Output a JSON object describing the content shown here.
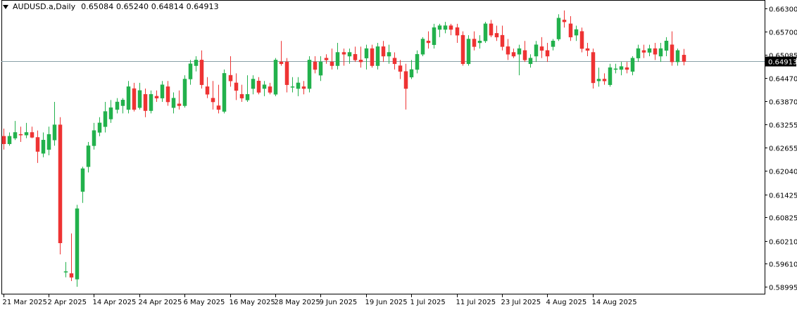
{
  "header": {
    "symbol": "AUDUSD.a,Daily",
    "open": "0.65084",
    "high": "0.65240",
    "low": "0.64814",
    "close": "0.64913"
  },
  "colors": {
    "bull": "#22b14c",
    "bear": "#ee3333",
    "current_price_line": "#8aa0a8",
    "axis": "#000000",
    "background": "#ffffff"
  },
  "chart_data": {
    "type": "candlestick",
    "symbol": "AUDUSD.a",
    "timeframe": "Daily",
    "ylim": [
      0.588,
      0.6645
    ],
    "y_ticks": [
      "0.66300",
      "0.65700",
      "0.65085",
      "0.64470",
      "0.63870",
      "0.63255",
      "0.62655",
      "0.62040",
      "0.61425",
      "0.60825",
      "0.60210",
      "0.59610",
      "0.58995"
    ],
    "current_price": "0.64913",
    "x_labels": [
      "21 Mar 2025",
      "2 Apr 2025",
      "14 Apr 2025",
      "24 Apr 2025",
      "6 May 2025",
      "16 May 2025",
      "28 May 2025",
      "9 Jun 2025",
      "19 Jun 2025",
      "1 Jul 2025",
      "11 Jul 2025",
      "23 Jul 2025",
      "4 Aug 2025",
      "14 Aug 2025"
    ],
    "x_label_index": [
      0,
      8,
      16,
      24,
      32,
      40,
      48,
      56,
      64,
      72,
      80,
      88,
      96,
      104
    ],
    "candles": [
      {
        "o": 0.6295,
        "h": 0.6315,
        "l": 0.626,
        "c": 0.6275
      },
      {
        "o": 0.6275,
        "h": 0.6305,
        "l": 0.627,
        "c": 0.6295
      },
      {
        "o": 0.629,
        "h": 0.6335,
        "l": 0.6285,
        "c": 0.6305
      },
      {
        "o": 0.63,
        "h": 0.632,
        "l": 0.628,
        "c": 0.6298
      },
      {
        "o": 0.6298,
        "h": 0.633,
        "l": 0.629,
        "c": 0.6305
      },
      {
        "o": 0.6305,
        "h": 0.632,
        "l": 0.629,
        "c": 0.6292
      },
      {
        "o": 0.6292,
        "h": 0.631,
        "l": 0.6225,
        "c": 0.6255
      },
      {
        "o": 0.625,
        "h": 0.6305,
        "l": 0.624,
        "c": 0.6285
      },
      {
        "o": 0.626,
        "h": 0.632,
        "l": 0.6245,
        "c": 0.63
      },
      {
        "o": 0.6285,
        "h": 0.6385,
        "l": 0.627,
        "c": 0.6325
      },
      {
        "o": 0.6325,
        "h": 0.6345,
        "l": 0.5985,
        "c": 0.6015
      },
      {
        "o": 0.594,
        "h": 0.5965,
        "l": 0.5925,
        "c": 0.594
      },
      {
        "o": 0.5935,
        "h": 0.604,
        "l": 0.5915,
        "c": 0.5925
      },
      {
        "o": 0.592,
        "h": 0.6115,
        "l": 0.59,
        "c": 0.6105
      },
      {
        "o": 0.615,
        "h": 0.6215,
        "l": 0.612,
        "c": 0.621
      },
      {
        "o": 0.6215,
        "h": 0.628,
        "l": 0.62,
        "c": 0.627
      },
      {
        "o": 0.627,
        "h": 0.633,
        "l": 0.626,
        "c": 0.631
      },
      {
        "o": 0.6305,
        "h": 0.6345,
        "l": 0.6295,
        "c": 0.633
      },
      {
        "o": 0.632,
        "h": 0.6385,
        "l": 0.6305,
        "c": 0.636
      },
      {
        "o": 0.634,
        "h": 0.639,
        "l": 0.633,
        "c": 0.637
      },
      {
        "o": 0.6365,
        "h": 0.6395,
        "l": 0.6355,
        "c": 0.6385
      },
      {
        "o": 0.6375,
        "h": 0.6395,
        "l": 0.6355,
        "c": 0.639
      },
      {
        "o": 0.6365,
        "h": 0.644,
        "l": 0.6355,
        "c": 0.6425
      },
      {
        "o": 0.642,
        "h": 0.6435,
        "l": 0.636,
        "c": 0.6365
      },
      {
        "o": 0.637,
        "h": 0.6435,
        "l": 0.6365,
        "c": 0.6415
      },
      {
        "o": 0.6405,
        "h": 0.642,
        "l": 0.6345,
        "c": 0.6362
      },
      {
        "o": 0.6362,
        "h": 0.6415,
        "l": 0.6355,
        "c": 0.6405
      },
      {
        "o": 0.64,
        "h": 0.6415,
        "l": 0.6385,
        "c": 0.6395
      },
      {
        "o": 0.6395,
        "h": 0.644,
        "l": 0.6385,
        "c": 0.643
      },
      {
        "o": 0.6425,
        "h": 0.644,
        "l": 0.6375,
        "c": 0.6385
      },
      {
        "o": 0.637,
        "h": 0.641,
        "l": 0.6355,
        "c": 0.6395
      },
      {
        "o": 0.638,
        "h": 0.6415,
        "l": 0.6365,
        "c": 0.6375
      },
      {
        "o": 0.6375,
        "h": 0.6455,
        "l": 0.637,
        "c": 0.6445
      },
      {
        "o": 0.6445,
        "h": 0.6495,
        "l": 0.643,
        "c": 0.6485
      },
      {
        "o": 0.648,
        "h": 0.6505,
        "l": 0.6465,
        "c": 0.6495
      },
      {
        "o": 0.6495,
        "h": 0.652,
        "l": 0.642,
        "c": 0.643
      },
      {
        "o": 0.6425,
        "h": 0.645,
        "l": 0.6395,
        "c": 0.6405
      },
      {
        "o": 0.6395,
        "h": 0.644,
        "l": 0.6365,
        "c": 0.6385
      },
      {
        "o": 0.6375,
        "h": 0.643,
        "l": 0.6355,
        "c": 0.6365
      },
      {
        "o": 0.636,
        "h": 0.647,
        "l": 0.6355,
        "c": 0.646
      },
      {
        "o": 0.6455,
        "h": 0.6505,
        "l": 0.6425,
        "c": 0.644
      },
      {
        "o": 0.6435,
        "h": 0.646,
        "l": 0.639,
        "c": 0.6415
      },
      {
        "o": 0.6405,
        "h": 0.643,
        "l": 0.6385,
        "c": 0.6395
      },
      {
        "o": 0.639,
        "h": 0.6455,
        "l": 0.6385,
        "c": 0.6405
      },
      {
        "o": 0.642,
        "h": 0.6455,
        "l": 0.6405,
        "c": 0.6445
      },
      {
        "o": 0.644,
        "h": 0.645,
        "l": 0.6405,
        "c": 0.641
      },
      {
        "o": 0.642,
        "h": 0.644,
        "l": 0.64,
        "c": 0.643
      },
      {
        "o": 0.6425,
        "h": 0.6435,
        "l": 0.6405,
        "c": 0.641
      },
      {
        "o": 0.6405,
        "h": 0.65,
        "l": 0.64,
        "c": 0.6495
      },
      {
        "o": 0.649,
        "h": 0.6545,
        "l": 0.648,
        "c": 0.6485
      },
      {
        "o": 0.649,
        "h": 0.65,
        "l": 0.641,
        "c": 0.643
      },
      {
        "o": 0.6425,
        "h": 0.645,
        "l": 0.641,
        "c": 0.6425
      },
      {
        "o": 0.642,
        "h": 0.645,
        "l": 0.64,
        "c": 0.6435
      },
      {
        "o": 0.6425,
        "h": 0.644,
        "l": 0.6405,
        "c": 0.642
      },
      {
        "o": 0.642,
        "h": 0.6505,
        "l": 0.641,
        "c": 0.6495
      },
      {
        "o": 0.649,
        "h": 0.6505,
        "l": 0.646,
        "c": 0.647
      },
      {
        "o": 0.6455,
        "h": 0.6505,
        "l": 0.644,
        "c": 0.649
      },
      {
        "o": 0.65,
        "h": 0.651,
        "l": 0.6485,
        "c": 0.6495
      },
      {
        "o": 0.649,
        "h": 0.6525,
        "l": 0.647,
        "c": 0.648
      },
      {
        "o": 0.648,
        "h": 0.654,
        "l": 0.647,
        "c": 0.6515
      },
      {
        "o": 0.6515,
        "h": 0.6525,
        "l": 0.648,
        "c": 0.651
      },
      {
        "o": 0.6505,
        "h": 0.6525,
        "l": 0.6485,
        "c": 0.6515
      },
      {
        "o": 0.651,
        "h": 0.653,
        "l": 0.649,
        "c": 0.6495
      },
      {
        "o": 0.6495,
        "h": 0.653,
        "l": 0.6475,
        "c": 0.649
      },
      {
        "o": 0.65,
        "h": 0.6535,
        "l": 0.647,
        "c": 0.6525
      },
      {
        "o": 0.6525,
        "h": 0.6535,
        "l": 0.6475,
        "c": 0.648
      },
      {
        "o": 0.648,
        "h": 0.654,
        "l": 0.647,
        "c": 0.653
      },
      {
        "o": 0.653,
        "h": 0.6545,
        "l": 0.649,
        "c": 0.6505
      },
      {
        "o": 0.6505,
        "h": 0.6535,
        "l": 0.6485,
        "c": 0.6515
      },
      {
        "o": 0.65,
        "h": 0.6515,
        "l": 0.647,
        "c": 0.6485
      },
      {
        "o": 0.648,
        "h": 0.6495,
        "l": 0.6445,
        "c": 0.6465
      },
      {
        "o": 0.6465,
        "h": 0.6485,
        "l": 0.6365,
        "c": 0.642
      },
      {
        "o": 0.645,
        "h": 0.6495,
        "l": 0.6445,
        "c": 0.647
      },
      {
        "o": 0.647,
        "h": 0.652,
        "l": 0.646,
        "c": 0.651
      },
      {
        "o": 0.651,
        "h": 0.6555,
        "l": 0.6505,
        "c": 0.655
      },
      {
        "o": 0.6545,
        "h": 0.657,
        "l": 0.6525,
        "c": 0.654
      },
      {
        "o": 0.6535,
        "h": 0.659,
        "l": 0.6525,
        "c": 0.658
      },
      {
        "o": 0.6575,
        "h": 0.659,
        "l": 0.6555,
        "c": 0.6585
      },
      {
        "o": 0.6575,
        "h": 0.6595,
        "l": 0.6565,
        "c": 0.6585
      },
      {
        "o": 0.6585,
        "h": 0.659,
        "l": 0.656,
        "c": 0.6575
      },
      {
        "o": 0.658,
        "h": 0.659,
        "l": 0.654,
        "c": 0.656
      },
      {
        "o": 0.656,
        "h": 0.657,
        "l": 0.648,
        "c": 0.6485
      },
      {
        "o": 0.6485,
        "h": 0.656,
        "l": 0.648,
        "c": 0.655
      },
      {
        "o": 0.655,
        "h": 0.657,
        "l": 0.652,
        "c": 0.653
      },
      {
        "o": 0.654,
        "h": 0.656,
        "l": 0.6525,
        "c": 0.6545
      },
      {
        "o": 0.6545,
        "h": 0.6595,
        "l": 0.654,
        "c": 0.659
      },
      {
        "o": 0.659,
        "h": 0.66,
        "l": 0.6555,
        "c": 0.656
      },
      {
        "o": 0.6565,
        "h": 0.6585,
        "l": 0.6545,
        "c": 0.6555
      },
      {
        "o": 0.656,
        "h": 0.6585,
        "l": 0.652,
        "c": 0.653
      },
      {
        "o": 0.653,
        "h": 0.655,
        "l": 0.6495,
        "c": 0.651
      },
      {
        "o": 0.6515,
        "h": 0.6525,
        "l": 0.65,
        "c": 0.6505
      },
      {
        "o": 0.651,
        "h": 0.6535,
        "l": 0.6455,
        "c": 0.6525
      },
      {
        "o": 0.652,
        "h": 0.6545,
        "l": 0.649,
        "c": 0.6495
      },
      {
        "o": 0.6485,
        "h": 0.651,
        "l": 0.6475,
        "c": 0.65
      },
      {
        "o": 0.6505,
        "h": 0.6545,
        "l": 0.649,
        "c": 0.6535
      },
      {
        "o": 0.653,
        "h": 0.6555,
        "l": 0.65,
        "c": 0.652
      },
      {
        "o": 0.652,
        "h": 0.654,
        "l": 0.649,
        "c": 0.6505
      },
      {
        "o": 0.653,
        "h": 0.655,
        "l": 0.652,
        "c": 0.6545
      },
      {
        "o": 0.655,
        "h": 0.6615,
        "l": 0.6545,
        "c": 0.6605
      },
      {
        "o": 0.66,
        "h": 0.6625,
        "l": 0.658,
        "c": 0.6595
      },
      {
        "o": 0.659,
        "h": 0.661,
        "l": 0.6545,
        "c": 0.6555
      },
      {
        "o": 0.656,
        "h": 0.6585,
        "l": 0.6545,
        "c": 0.6575
      },
      {
        "o": 0.657,
        "h": 0.658,
        "l": 0.6515,
        "c": 0.6525
      },
      {
        "o": 0.6525,
        "h": 0.654,
        "l": 0.6505,
        "c": 0.652
      },
      {
        "o": 0.6515,
        "h": 0.6525,
        "l": 0.642,
        "c": 0.6435
      },
      {
        "o": 0.644,
        "h": 0.6475,
        "l": 0.6425,
        "c": 0.6445
      },
      {
        "o": 0.6445,
        "h": 0.646,
        "l": 0.643,
        "c": 0.644
      },
      {
        "o": 0.643,
        "h": 0.6485,
        "l": 0.6425,
        "c": 0.6475
      },
      {
        "o": 0.647,
        "h": 0.6485,
        "l": 0.646,
        "c": 0.6472
      },
      {
        "o": 0.647,
        "h": 0.649,
        "l": 0.6455,
        "c": 0.6478
      },
      {
        "o": 0.6475,
        "h": 0.649,
        "l": 0.646,
        "c": 0.647
      },
      {
        "o": 0.6465,
        "h": 0.6505,
        "l": 0.6455,
        "c": 0.65
      },
      {
        "o": 0.65,
        "h": 0.6535,
        "l": 0.649,
        "c": 0.6525
      },
      {
        "o": 0.652,
        "h": 0.6535,
        "l": 0.65,
        "c": 0.6515
      },
      {
        "o": 0.6515,
        "h": 0.6535,
        "l": 0.6505,
        "c": 0.6525
      },
      {
        "o": 0.6525,
        "h": 0.654,
        "l": 0.6495,
        "c": 0.651
      },
      {
        "o": 0.6505,
        "h": 0.654,
        "l": 0.649,
        "c": 0.6525
      },
      {
        "o": 0.652,
        "h": 0.6555,
        "l": 0.6505,
        "c": 0.6545
      },
      {
        "o": 0.6535,
        "h": 0.657,
        "l": 0.648,
        "c": 0.649
      },
      {
        "o": 0.649,
        "h": 0.6525,
        "l": 0.648,
        "c": 0.652
      },
      {
        "o": 0.6508,
        "h": 0.6524,
        "l": 0.6481,
        "c": 0.6491
      }
    ]
  }
}
